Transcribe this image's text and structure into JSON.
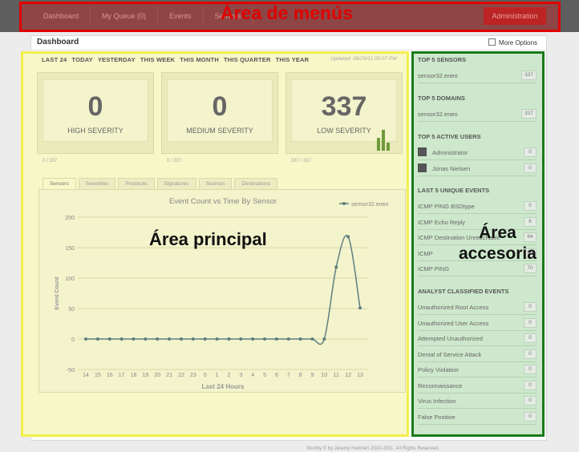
{
  "nav": {
    "items": [
      "Dashboard",
      "My Queue (0)",
      "Events",
      "Sensors"
    ],
    "admin": "Administration"
  },
  "overlays": {
    "menus": "Área de menús",
    "principal": "Área principal",
    "accesoria_1": "Área",
    "accesoria_2": "accesoria"
  },
  "page": {
    "title": "Dashboard",
    "more_options": "More Options"
  },
  "time_tabs": [
    "LAST 24",
    "TODAY",
    "YESTERDAY",
    "THIS WEEK",
    "THIS MONTH",
    "THIS QUARTER",
    "THIS YEAR"
  ],
  "updated": "Updated: 08/29/11 05:07 PM",
  "severity": [
    {
      "count": "0",
      "label": "HIGH SEVERITY",
      "foot": "0 / 337"
    },
    {
      "count": "0",
      "label": "MEDIUM SEVERITY",
      "foot": "0 / 337"
    },
    {
      "count": "337",
      "label": "LOW SEVERITY",
      "foot": "337 / 337"
    }
  ],
  "chart_tabs": [
    "Sensors",
    "Severities",
    "Protocols",
    "Signatures",
    "Sources",
    "Destinations"
  ],
  "sidebar": {
    "top_sensors": {
      "title": "TOP 5 SENSORS",
      "items": [
        {
          "label": "sensor32.eneo",
          "count": "337"
        }
      ]
    },
    "top_domains": {
      "title": "TOP 5 DOMAINS",
      "items": [
        {
          "label": "sensor32.eneo",
          "count": "337"
        }
      ]
    },
    "active_users": {
      "title": "TOP 5 ACTIVE USERS",
      "items": [
        {
          "label": "Administrator",
          "count": "0"
        },
        {
          "label": "Jonas Nielsen",
          "count": "0"
        }
      ]
    },
    "unique_events": {
      "title": "LAST 5 UNIQUE EVENTS",
      "items": [
        {
          "label": "ICMP PING BSDtype",
          "count": "5"
        },
        {
          "label": "ICMP Echo Reply",
          "count": "6"
        },
        {
          "label": "ICMP Destination Unreachable",
          "count": "84"
        },
        {
          "label": "ICMP",
          "count": "96"
        },
        {
          "label": "ICMP PING",
          "count": "70"
        }
      ]
    },
    "classified": {
      "title": "ANALYST CLASSIFIED EVENTS",
      "items": [
        {
          "label": "Unauthorized Root Access",
          "count": "0"
        },
        {
          "label": "Unauthorized User Access",
          "count": "0"
        },
        {
          "label": "Attempted Unauthorized",
          "count": "0"
        },
        {
          "label": "Denial of Service Attack",
          "count": "0"
        },
        {
          "label": "Policy Violation",
          "count": "0"
        },
        {
          "label": "Reconnaissance",
          "count": "0"
        },
        {
          "label": "Virus Infection",
          "count": "0"
        },
        {
          "label": "False Positive",
          "count": "0"
        }
      ]
    }
  },
  "footer": "Snorby © by Jeremy Hatchen 2010-2011. All Rights Reserved.",
  "chart_data": {
    "type": "line",
    "title": "Event Count vs Time By Sensor",
    "xlabel": "Last 24 Hours",
    "ylabel": "Event Count",
    "categories": [
      "14",
      "15",
      "16",
      "17",
      "18",
      "19",
      "20",
      "21",
      "22",
      "23",
      "0",
      "1",
      "2",
      "3",
      "4",
      "5",
      "6",
      "7",
      "8",
      "9",
      "10",
      "11",
      "12",
      "13"
    ],
    "series": [
      {
        "name": "sensor32.eneo",
        "values": [
          0,
          0,
          0,
          0,
          0,
          0,
          0,
          0,
          0,
          0,
          0,
          0,
          0,
          0,
          0,
          0,
          0,
          0,
          0,
          0,
          0,
          118,
          168,
          51
        ]
      }
    ],
    "ylim": [
      -50,
      200
    ],
    "yticks": [
      -50,
      0,
      50,
      100,
      150,
      200
    ],
    "grid": true,
    "legend": "top-right",
    "colors": {
      "line": "#5f7f7f",
      "grid": "#d8d8a8"
    }
  },
  "colors": {
    "menu_overlay": "#e00000",
    "main_overlay": "#f2ef4a",
    "side_overlay": "#1a7a1a",
    "admin": "#b22222"
  }
}
